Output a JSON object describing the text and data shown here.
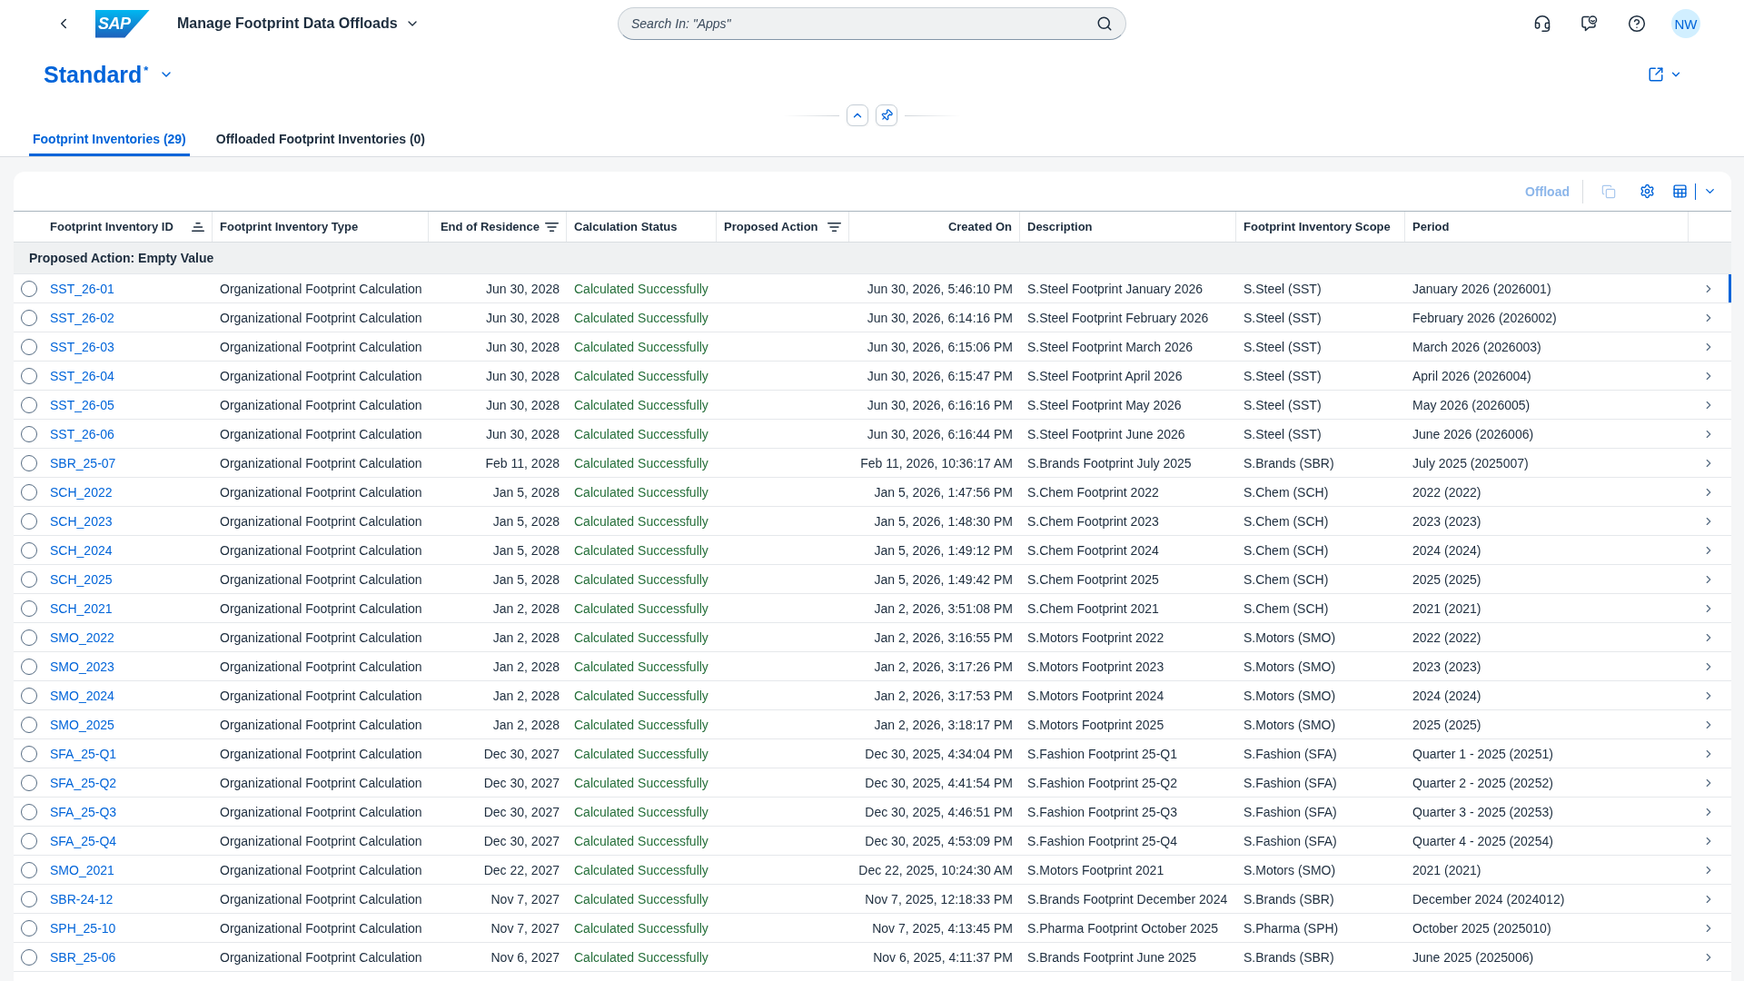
{
  "shell": {
    "logo": "SAP",
    "app_title": "Manage Footprint Data Offloads",
    "search": {
      "placeholder": "Search In: \"Apps\""
    },
    "avatar": "NW"
  },
  "variant": {
    "title": "Standard$^{*}$"
  },
  "tabs": [
    {
      "label": "Footprint Inventories (29)",
      "selected": true
    },
    {
      "label": "Offloaded Footprint Inventories (0)",
      "selected": false
    }
  ],
  "toolbar": {
    "offload_button": {
      "label": "Offload",
      "disabled": true
    },
    "copy_button": {
      "disabled": true
    }
  },
  "table": {
    "columns": [
      {
        "label": "Footprint Inventory ID",
        "kind": "link",
        "sorted": true,
        "filtered": false
      },
      {
        "label": "Footprint Inventory Type",
        "kind": "text",
        "sorted": false,
        "filtered": false
      },
      {
        "label": "End of Residence",
        "kind": "date",
        "sorted": false,
        "filtered": true
      },
      {
        "label": "Calculation Status",
        "kind": "status",
        "sorted": false,
        "filtered": false
      },
      {
        "label": "Proposed Action",
        "kind": "text",
        "sorted": false,
        "filtered": true
      },
      {
        "label": "Created On",
        "kind": "date",
        "sorted": false,
        "filtered": false
      },
      {
        "label": "Description",
        "kind": "text",
        "sorted": false,
        "filtered": false
      },
      {
        "label": "Footprint Inventory Scope",
        "kind": "text",
        "sorted": false,
        "filtered": false
      },
      {
        "label": "Period",
        "kind": "text",
        "sorted": false,
        "filtered": false
      }
    ],
    "group_header": "Proposed Action: Empty Value",
    "rows": [
      {
        "selected": false,
        "navigated": true,
        "inventory_id": "SST_26-01",
        "inventory_type": "Organizational Footprint Calculation",
        "end_of_residence": "Jun 30, 2028",
        "calculation_status": "Calculated Successfully",
        "created_on": "Jun 30, 2026, 5:46:10 PM",
        "description": "S.Steel Footprint January 2026",
        "scope": "S.Steel (SST)",
        "period": "January 2026 (2026001)"
      },
      {
        "selected": false,
        "navigated": false,
        "inventory_id": "SST_26-02",
        "inventory_type": "Organizational Footprint Calculation",
        "end_of_residence": "Jun 30, 2028",
        "calculation_status": "Calculated Successfully",
        "created_on": "Jun 30, 2026, 6:14:16 PM",
        "description": "S.Steel Footprint February 2026",
        "scope": "S.Steel (SST)",
        "period": "February 2026 (2026002)"
      },
      {
        "selected": false,
        "navigated": false,
        "inventory_id": "SST_26-03",
        "inventory_type": "Organizational Footprint Calculation",
        "end_of_residence": "Jun 30, 2028",
        "calculation_status": "Calculated Successfully",
        "created_on": "Jun 30, 2026, 6:15:06 PM",
        "description": "S.Steel Footprint March 2026",
        "scope": "S.Steel (SST)",
        "period": "March 2026 (2026003)"
      },
      {
        "selected": false,
        "navigated": false,
        "inventory_id": "SST_26-04",
        "inventory_type": "Organizational Footprint Calculation",
        "end_of_residence": "Jun 30, 2028",
        "calculation_status": "Calculated Successfully",
        "created_on": "Jun 30, 2026, 6:15:47 PM",
        "description": "S.Steel Footprint April 2026",
        "scope": "S.Steel (SST)",
        "period": "April 2026 (2026004)"
      },
      {
        "selected": false,
        "navigated": false,
        "inventory_id": "SST_26-05",
        "inventory_type": "Organizational Footprint Calculation",
        "end_of_residence": "Jun 30, 2028",
        "calculation_status": "Calculated Successfully",
        "created_on": "Jun 30, 2026, 6:16:16 PM",
        "description": "S.Steel Footprint May 2026",
        "scope": "S.Steel (SST)",
        "period": "May 2026 (2026005)"
      },
      {
        "selected": false,
        "navigated": false,
        "inventory_id": "SST_26-06",
        "inventory_type": "Organizational Footprint Calculation",
        "end_of_residence": "Jun 30, 2028",
        "calculation_status": "Calculated Successfully",
        "created_on": "Jun 30, 2026, 6:16:44 PM",
        "description": "S.Steel Footprint June 2026",
        "scope": "S.Steel (SST)",
        "period": "June 2026 (2026006)"
      },
      {
        "selected": false,
        "navigated": false,
        "inventory_id": "SBR_25-07",
        "inventory_type": "Organizational Footprint Calculation",
        "end_of_residence": "Feb 11, 2028",
        "calculation_status": "Calculated Successfully",
        "created_on": "Feb 11, 2026, 10:36:17 AM",
        "description": "S.Brands Footprint July 2025",
        "scope": "S.Brands (SBR)",
        "period": "July 2025 (2025007)"
      },
      {
        "selected": false,
        "navigated": false,
        "inventory_id": "SCH_2022",
        "inventory_type": "Organizational Footprint Calculation",
        "end_of_residence": "Jan 5, 2028",
        "calculation_status": "Calculated Successfully",
        "created_on": "Jan 5, 2026, 1:47:56 PM",
        "description": "S.Chem Footprint 2022",
        "scope": "S.Chem (SCH)",
        "period": "2022 (2022)"
      },
      {
        "selected": false,
        "navigated": false,
        "inventory_id": "SCH_2023",
        "inventory_type": "Organizational Footprint Calculation",
        "end_of_residence": "Jan 5, 2028",
        "calculation_status": "Calculated Successfully",
        "created_on": "Jan 5, 2026, 1:48:30 PM",
        "description": "S.Chem Footprint 2023",
        "scope": "S.Chem (SCH)",
        "period": "2023 (2023)"
      },
      {
        "selected": false,
        "navigated": false,
        "inventory_id": "SCH_2024",
        "inventory_type": "Organizational Footprint Calculation",
        "end_of_residence": "Jan 5, 2028",
        "calculation_status": "Calculated Successfully",
        "created_on": "Jan 5, 2026, 1:49:12 PM",
        "description": "S.Chem Footprint 2024",
        "scope": "S.Chem (SCH)",
        "period": "2024 (2024)"
      },
      {
        "selected": false,
        "navigated": false,
        "inventory_id": "SCH_2025",
        "inventory_type": "Organizational Footprint Calculation",
        "end_of_residence": "Jan 5, 2028",
        "calculation_status": "Calculated Successfully",
        "created_on": "Jan 5, 2026, 1:49:42 PM",
        "description": "S.Chem Footprint 2025",
        "scope": "S.Chem (SCH)",
        "period": "2025 (2025)"
      },
      {
        "selected": false,
        "navigated": false,
        "inventory_id": "SCH_2021",
        "inventory_type": "Organizational Footprint Calculation",
        "end_of_residence": "Jan 2, 2028",
        "calculation_status": "Calculated Successfully",
        "created_on": "Jan 2, 2026, 3:51:08 PM",
        "description": "S.Chem Footprint 2021",
        "scope": "S.Chem (SCH)",
        "period": "2021 (2021)"
      },
      {
        "selected": false,
        "navigated": false,
        "inventory_id": "SMO_2022",
        "inventory_type": "Organizational Footprint Calculation",
        "end_of_residence": "Jan 2, 2028",
        "calculation_status": "Calculated Successfully",
        "created_on": "Jan 2, 2026, 3:16:55 PM",
        "description": "S.Motors Footprint 2022",
        "scope": "S.Motors (SMO)",
        "period": "2022 (2022)"
      },
      {
        "selected": false,
        "navigated": false,
        "inventory_id": "SMO_2023",
        "inventory_type": "Organizational Footprint Calculation",
        "end_of_residence": "Jan 2, 2028",
        "calculation_status": "Calculated Successfully",
        "created_on": "Jan 2, 2026, 3:17:26 PM",
        "description": "S.Motors Footprint 2023",
        "scope": "S.Motors (SMO)",
        "period": "2023 (2023)"
      },
      {
        "selected": false,
        "navigated": false,
        "inventory_id": "SMO_2024",
        "inventory_type": "Organizational Footprint Calculation",
        "end_of_residence": "Jan 2, 2028",
        "calculation_status": "Calculated Successfully",
        "created_on": "Jan 2, 2026, 3:17:53 PM",
        "description": "S.Motors Footprint 2024",
        "scope": "S.Motors (SMO)",
        "period": "2024 (2024)"
      },
      {
        "selected": false,
        "navigated": false,
        "inventory_id": "SMO_2025",
        "inventory_type": "Organizational Footprint Calculation",
        "end_of_residence": "Jan 2, 2028",
        "calculation_status": "Calculated Successfully",
        "created_on": "Jan 2, 2026, 3:18:17 PM",
        "description": "S.Motors Footprint 2025",
        "scope": "S.Motors (SMO)",
        "period": "2025 (2025)"
      },
      {
        "selected": false,
        "navigated": false,
        "inventory_id": "SFA_25-Q1",
        "inventory_type": "Organizational Footprint Calculation",
        "end_of_residence": "Dec 30, 2027",
        "calculation_status": "Calculated Successfully",
        "created_on": "Dec 30, 2025, 4:34:04 PM",
        "description": "S.Fashion Footprint 25-Q1",
        "scope": "S.Fashion (SFA)",
        "period": "Quarter 1 - 2025 (20251)"
      },
      {
        "selected": false,
        "navigated": false,
        "inventory_id": "SFA_25-Q2",
        "inventory_type": "Organizational Footprint Calculation",
        "end_of_residence": "Dec 30, 2027",
        "calculation_status": "Calculated Successfully",
        "created_on": "Dec 30, 2025, 4:41:54 PM",
        "description": "S.Fashion Footprint 25-Q2",
        "scope": "S.Fashion (SFA)",
        "period": "Quarter 2 - 2025 (20252)"
      },
      {
        "selected": false,
        "navigated": false,
        "inventory_id": "SFA_25-Q3",
        "inventory_type": "Organizational Footprint Calculation",
        "end_of_residence": "Dec 30, 2027",
        "calculation_status": "Calculated Successfully",
        "created_on": "Dec 30, 2025, 4:46:51 PM",
        "description": "S.Fashion Footprint 25-Q3",
        "scope": "S.Fashion (SFA)",
        "period": "Quarter 3 - 2025 (20253)"
      },
      {
        "selected": false,
        "navigated": false,
        "inventory_id": "SFA_25-Q4",
        "inventory_type": "Organizational Footprint Calculation",
        "end_of_residence": "Dec 30, 2027",
        "calculation_status": "Calculated Successfully",
        "created_on": "Dec 30, 2025, 4:53:09 PM",
        "description": "S.Fashion Footprint 25-Q4",
        "scope": "S.Fashion (SFA)",
        "period": "Quarter 4 - 2025 (20254)"
      },
      {
        "selected": false,
        "navigated": false,
        "inventory_id": "SMO_2021",
        "inventory_type": "Organizational Footprint Calculation",
        "end_of_residence": "Dec 22, 2027",
        "calculation_status": "Calculated Successfully",
        "created_on": "Dec 22, 2025, 10:24:30 AM",
        "description": "S.Motors Footprint 2021",
        "scope": "S.Motors (SMO)",
        "period": "2021 (2021)"
      },
      {
        "selected": false,
        "navigated": false,
        "inventory_id": "SBR-24-12",
        "inventory_type": "Organizational Footprint Calculation",
        "end_of_residence": "Nov 7, 2027",
        "calculation_status": "Calculated Successfully",
        "created_on": "Nov 7, 2025, 12:18:33 PM",
        "description": "S.Brands Footprint December 2024",
        "scope": "S.Brands (SBR)",
        "period": "December 2024 (2024012)"
      },
      {
        "selected": false,
        "navigated": false,
        "inventory_id": "SPH_25-10",
        "inventory_type": "Organizational Footprint Calculation",
        "end_of_residence": "Nov 7, 2027",
        "calculation_status": "Calculated Successfully",
        "created_on": "Nov 7, 2025, 4:13:45 PM",
        "description": "S.Pharma Footprint October 2025",
        "scope": "S.Pharma (SPH)",
        "period": "October 2025 (2025010)"
      },
      {
        "selected": false,
        "navigated": false,
        "inventory_id": "SBR_25-06",
        "inventory_type": "Organizational Footprint Calculation",
        "end_of_residence": "Nov 6, 2027",
        "calculation_status": "Calculated Successfully",
        "created_on": "Nov 6, 2025, 4:11:37 PM",
        "description": "S.Brands Footprint June 2025",
        "scope": "S.Brands (SBR)",
        "period": "June 2025 (2025006)"
      }
    ]
  }
}
